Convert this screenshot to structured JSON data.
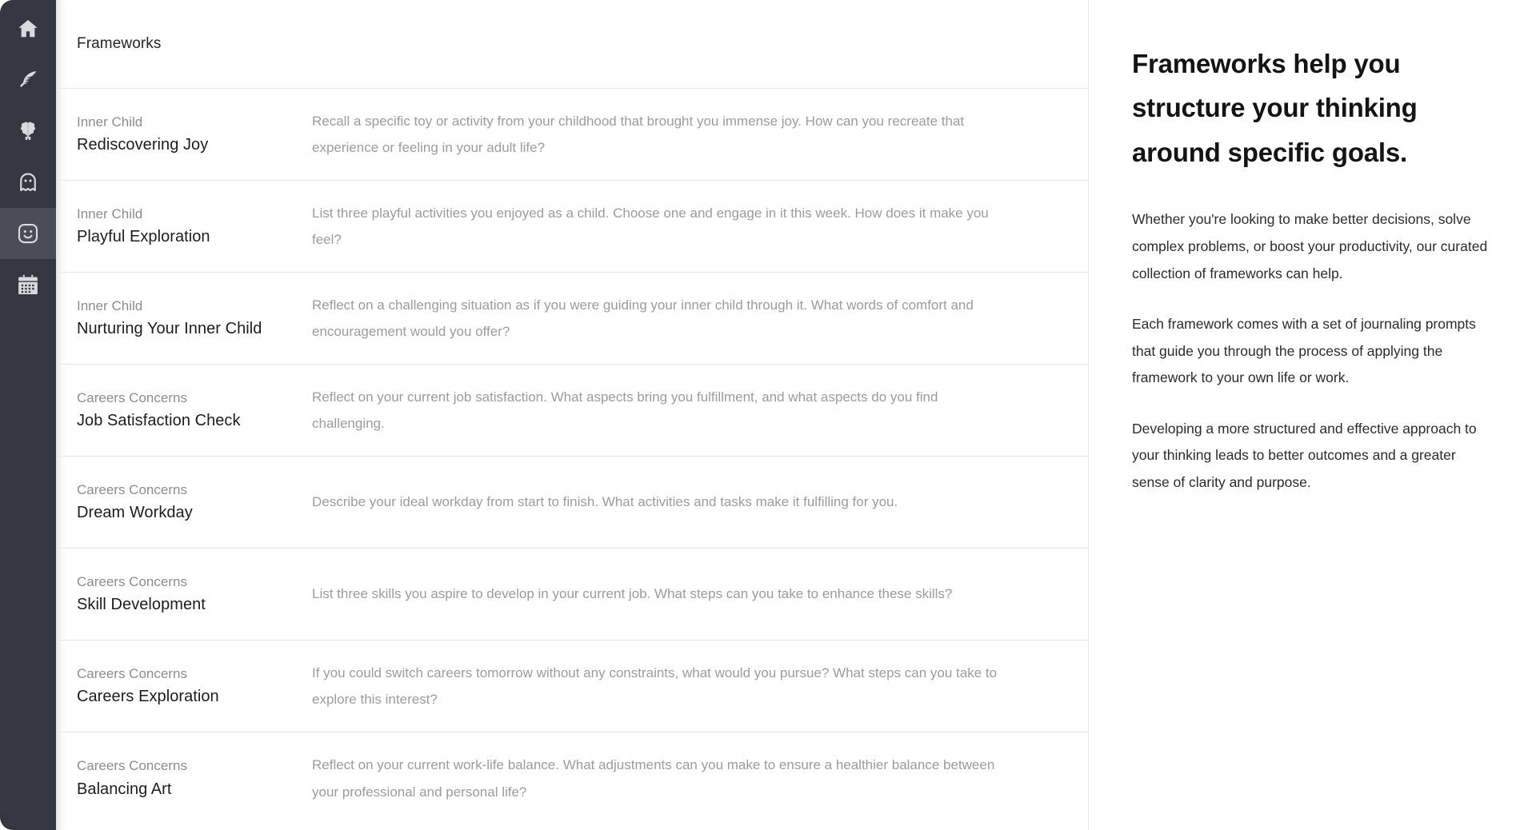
{
  "sidebar": {
    "items": [
      {
        "icon": "home-icon",
        "name": "home",
        "active": false
      },
      {
        "icon": "feather-icon",
        "name": "journal",
        "active": false
      },
      {
        "icon": "brain-icon",
        "name": "mind",
        "active": false
      },
      {
        "icon": "ghost-icon",
        "name": "ghost",
        "active": false
      },
      {
        "icon": "smiley-face-icon",
        "name": "frameworks",
        "active": true
      },
      {
        "icon": "calendar-icon",
        "name": "calendar",
        "active": false
      }
    ]
  },
  "list": {
    "header_title": "Frameworks",
    "rows": [
      {
        "category": "Inner Child",
        "title": "Rediscovering Joy",
        "prompt": "Recall a specific toy or activity from your childhood that brought you immense joy. How can you recreate that experience or feeling in your adult life?"
      },
      {
        "category": "Inner Child",
        "title": "Playful Exploration",
        "prompt": "List three playful activities you enjoyed as a child. Choose one and engage in it this week. How does it make you feel?"
      },
      {
        "category": "Inner Child",
        "title": "Nurturing Your Inner Child",
        "prompt": "Reflect on a challenging situation as if you were guiding your inner child through it. What words of comfort and encouragement would you offer?"
      },
      {
        "category": "Careers Concerns",
        "title": "Job Satisfaction Check",
        "prompt": "Reflect on your current job satisfaction. What aspects bring you fulfillment, and what aspects do you find challenging."
      },
      {
        "category": "Careers Concerns",
        "title": "Dream Workday",
        "prompt": "Describe your ideal workday from start to finish. What activities and tasks make it fulfilling for you."
      },
      {
        "category": "Careers Concerns",
        "title": "Skill Development",
        "prompt": "List three skills you aspire to develop in your current job. What steps can you take to enhance these skills?"
      },
      {
        "category": "Careers Concerns",
        "title": "Careers Exploration",
        "prompt": "If you could switch careers tomorrow without any constraints, what would you pursue? What steps can you take to explore this interest?"
      },
      {
        "category": "Careers Concerns",
        "title": "Balancing Art",
        "prompt": "Reflect on your current work-life balance. What adjustments can you make to ensure a healthier balance between your professional and personal life?"
      }
    ]
  },
  "info": {
    "heading": "Frameworks help you structure your thinking around specific goals.",
    "paragraphs": [
      "Whether you're looking to make better decisions, solve complex problems, or boost your productivity, our curated collection of frameworks can help.",
      "Each framework comes with a set of journaling prompts that guide you through the process of applying the framework to your own life or work.",
      "Developing a more structured and effective approach to your thinking leads to better outcomes and a greater sense of clarity and purpose."
    ]
  },
  "colors": {
    "rail_bg": "#343741",
    "rail_active": "#4a4d57",
    "icon": "#d9dadd",
    "divider": "#e7e7e9",
    "muted_text": "#9a9ca1",
    "title_text": "#1d1d1f"
  }
}
